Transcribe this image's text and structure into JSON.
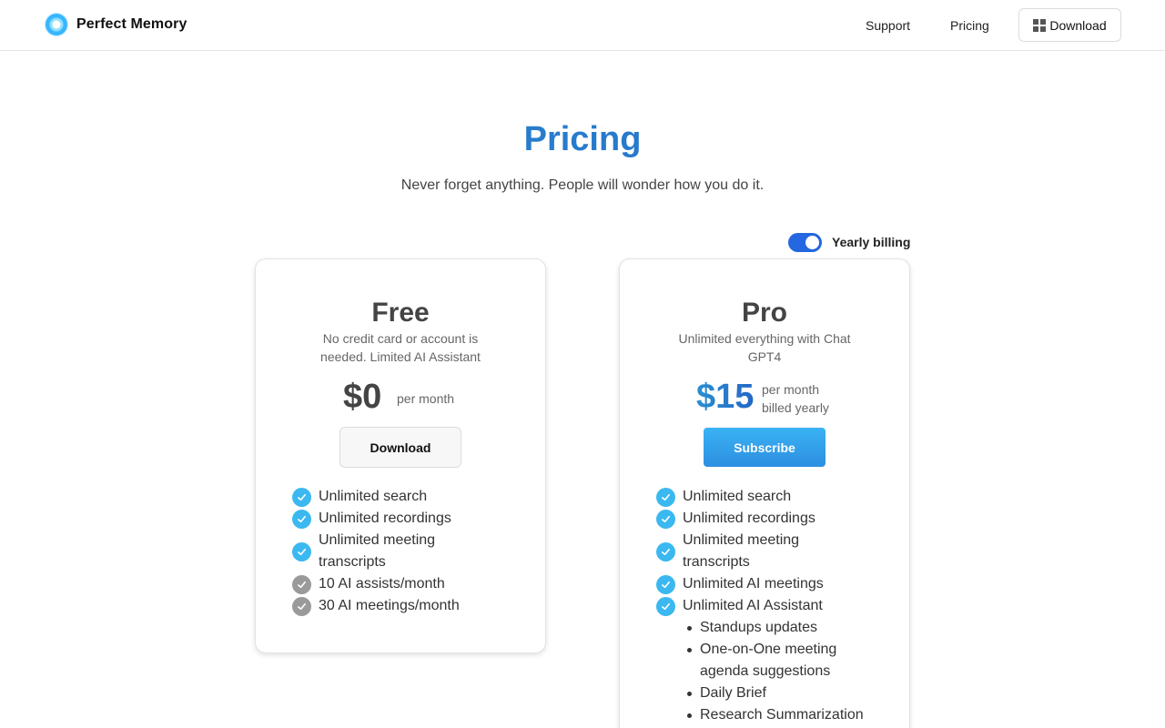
{
  "header": {
    "brand": "Perfect Memory",
    "nav": {
      "support": "Support",
      "pricing": "Pricing",
      "download": "Download"
    }
  },
  "hero": {
    "title": "Pricing",
    "subtitle": "Never forget anything. People will wonder how you do it."
  },
  "billing_toggle": {
    "label": "Yearly billing",
    "on": true
  },
  "plans": [
    {
      "name": "Free",
      "description": "No credit card or account is needed. Limited AI Assistant",
      "price": "$0",
      "period": "per month",
      "cta": "Download",
      "features": [
        {
          "text": "Unlimited search",
          "included": true
        },
        {
          "text": "Unlimited recordings",
          "included": true
        },
        {
          "text": "Unlimited meeting transcripts",
          "included": true
        },
        {
          "text": "10 AI assists/month",
          "included": false
        },
        {
          "text": "30 AI meetings/month",
          "included": false
        }
      ]
    },
    {
      "name": "Pro",
      "description": "Unlimited everything with Chat GPT4",
      "price": "$15",
      "period": "per month",
      "billing_note": "billed yearly",
      "cta": "Subscribe",
      "features": [
        {
          "text": "Unlimited search",
          "included": true
        },
        {
          "text": "Unlimited recordings",
          "included": true
        },
        {
          "text": "Unlimited meeting transcripts",
          "included": true
        },
        {
          "text": "Unlimited AI meetings",
          "included": true
        },
        {
          "text": "Unlimited AI Assistant",
          "included": true
        }
      ],
      "assistant_items": [
        "Standups updates",
        "One-on-One meeting agenda suggestions",
        "Daily Brief",
        "Research Summarization"
      ]
    }
  ],
  "colors": {
    "accent_blue": "#2467c7",
    "check_included": "#3bb8f0",
    "check_limited": "#9a9a9a",
    "toggle_on": "#2467e0"
  }
}
